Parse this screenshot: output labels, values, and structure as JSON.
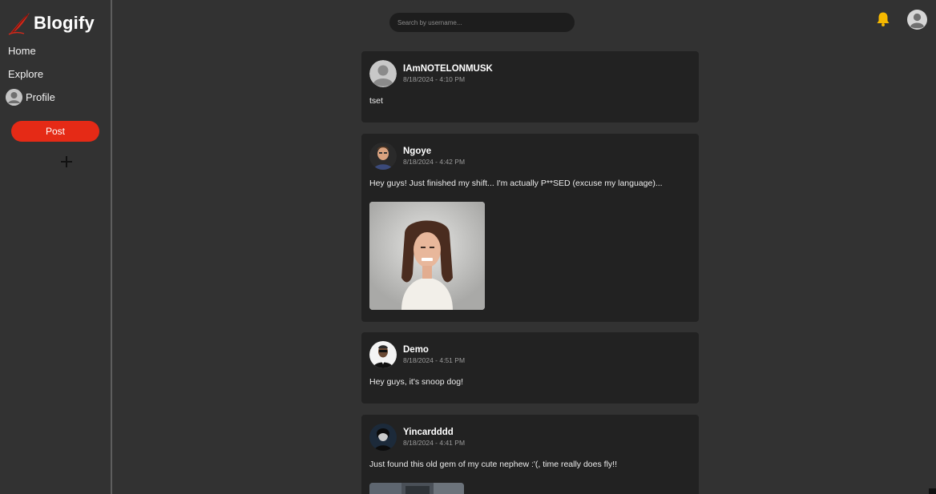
{
  "app": {
    "brand": "Blogify",
    "brand_color": "#e52a16"
  },
  "sidebar": {
    "items": [
      {
        "label": "Home"
      },
      {
        "label": "Explore"
      },
      {
        "label": "Profile",
        "icon": "avatar-icon"
      }
    ],
    "post_button": "Post",
    "add_icon": "plus-icon"
  },
  "header": {
    "search_placeholder": "Search by username...",
    "notification_icon": "bell-icon",
    "notification_color": "#f5b800",
    "account_icon": "user-avatar-icon"
  },
  "posts": [
    {
      "username": "IAmNOTELONMUSK",
      "timestamp": "8/18/2024 - 4:10 PM",
      "content": "tset",
      "avatar": "default-avatar"
    },
    {
      "username": "Ngoye",
      "timestamp": "8/18/2024 - 4:42 PM",
      "content": "Hey guys! Just finished my shift... I'm actually P**SED (excuse my language)...",
      "avatar": "photo-avatar",
      "image": "angry-woman-photo"
    },
    {
      "username": "Demo",
      "timestamp": "8/18/2024 - 4:51 PM",
      "content": "Hey guys, it's snoop dog!",
      "avatar": "photo-avatar"
    },
    {
      "username": "Yincardddd",
      "timestamp": "8/18/2024 - 4:41 PM",
      "content": "Just found this old gem of my cute nephew :'(, time really does fly!!",
      "avatar": "photo-avatar",
      "image": "old-photo"
    }
  ]
}
